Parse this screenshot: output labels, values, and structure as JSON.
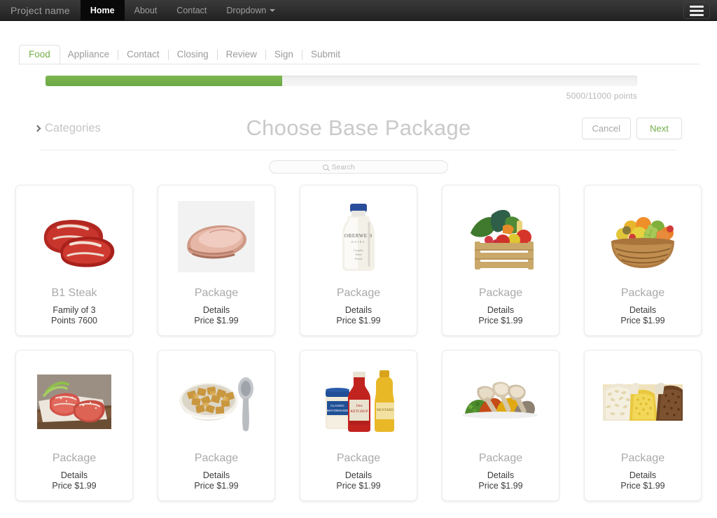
{
  "navbar": {
    "brand": "Project name",
    "links": [
      {
        "label": "Home",
        "active": true
      },
      {
        "label": "About",
        "active": false
      },
      {
        "label": "Contact",
        "active": false
      },
      {
        "label": "Dropdown",
        "active": false,
        "caret": true
      }
    ],
    "toggle_icon": "hamburger-menu-icon"
  },
  "tabs": [
    {
      "label": "Food",
      "active": true
    },
    {
      "label": "Appliance",
      "active": false
    },
    {
      "label": "Contact",
      "active": false
    },
    {
      "label": "Closing",
      "active": false
    },
    {
      "label": "Review",
      "active": false
    },
    {
      "label": "Sign",
      "active": false
    },
    {
      "label": "Submit",
      "active": false
    }
  ],
  "progress": {
    "label": "5000/11000 points",
    "current": 5000,
    "total": 11000,
    "percent": 40,
    "fill_color": "#76b24c",
    "track_color": "#efefef"
  },
  "header": {
    "categories_label": "Categories",
    "title": "Choose Base Package",
    "cancel_label": "Cancel",
    "next_label": "Next",
    "next_color": "#72ad48"
  },
  "search": {
    "placeholder": "Search",
    "value": "",
    "icon": "search-icon"
  },
  "cards": [
    {
      "title": "B1 Steak",
      "line1": "Family of 3",
      "line2": "Points 7600",
      "image": "steak"
    },
    {
      "title": "Package",
      "line1": "Details",
      "line2": "Price $1.99",
      "image": "ham"
    },
    {
      "title": "Package",
      "line1": "Details",
      "line2": "Price $1.99",
      "image": "milk"
    },
    {
      "title": "Package",
      "line1": "Details",
      "line2": "Price $1.99",
      "image": "vegetables"
    },
    {
      "title": "Package",
      "line1": "Details",
      "line2": "Price $1.99",
      "image": "fruit"
    },
    {
      "title": "Package",
      "line1": "Details",
      "line2": "Price $1.99",
      "image": "salmon"
    },
    {
      "title": "Package",
      "line1": "Details",
      "line2": "Price $1.99",
      "image": "cereal"
    },
    {
      "title": "Package",
      "line1": "Details",
      "line2": "Price $1.99",
      "image": "condiments"
    },
    {
      "title": "Package",
      "line1": "Details",
      "line2": "Price $1.99",
      "image": "spices"
    },
    {
      "title": "Package",
      "line1": "Details",
      "line2": "Price $1.99",
      "image": "grains"
    }
  ]
}
